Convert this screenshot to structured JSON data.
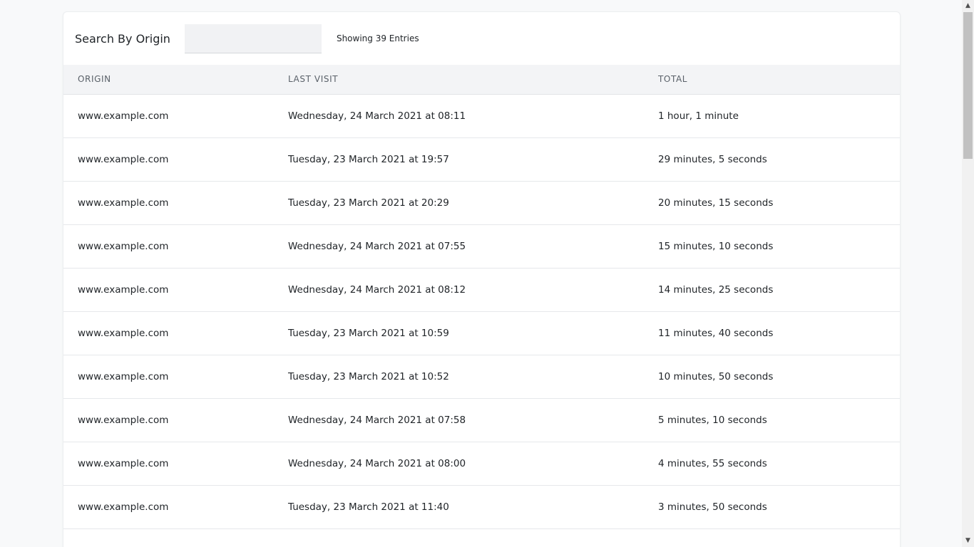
{
  "toolbar": {
    "search_label": "Search By Origin",
    "search_value": "",
    "search_placeholder": "",
    "entries_text": "Showing 39 Entries"
  },
  "table": {
    "columns": [
      "ORIGIN",
      "LAST VISIT",
      "TOTAL"
    ],
    "rows": [
      {
        "origin": "www.example.com",
        "last_visit": "Wednesday, 24 March 2021 at 08:11",
        "total": "1 hour, 1 minute"
      },
      {
        "origin": "www.example.com",
        "last_visit": "Tuesday, 23 March 2021 at 19:57",
        "total": "29 minutes, 5 seconds"
      },
      {
        "origin": "www.example.com",
        "last_visit": "Tuesday, 23 March 2021 at 20:29",
        "total": "20 minutes, 15 seconds"
      },
      {
        "origin": "www.example.com",
        "last_visit": "Wednesday, 24 March 2021 at 07:55",
        "total": "15 minutes, 10 seconds"
      },
      {
        "origin": "www.example.com",
        "last_visit": "Wednesday, 24 March 2021 at 08:12",
        "total": "14 minutes, 25 seconds"
      },
      {
        "origin": "www.example.com",
        "last_visit": "Tuesday, 23 March 2021 at 10:59",
        "total": "11 minutes, 40 seconds"
      },
      {
        "origin": "www.example.com",
        "last_visit": "Tuesday, 23 March 2021 at 10:52",
        "total": "10 minutes, 50 seconds"
      },
      {
        "origin": "www.example.com",
        "last_visit": "Wednesday, 24 March 2021 at 07:58",
        "total": "5 minutes, 10 seconds"
      },
      {
        "origin": "www.example.com",
        "last_visit": "Wednesday, 24 March 2021 at 08:00",
        "total": "4 minutes, 55 seconds"
      },
      {
        "origin": "www.example.com",
        "last_visit": "Tuesday, 23 March 2021 at 11:40",
        "total": "3 minutes, 50 seconds"
      }
    ]
  },
  "scrollbar": {
    "up_icon": "triangle-up-icon",
    "down_icon": "triangle-down-icon"
  }
}
